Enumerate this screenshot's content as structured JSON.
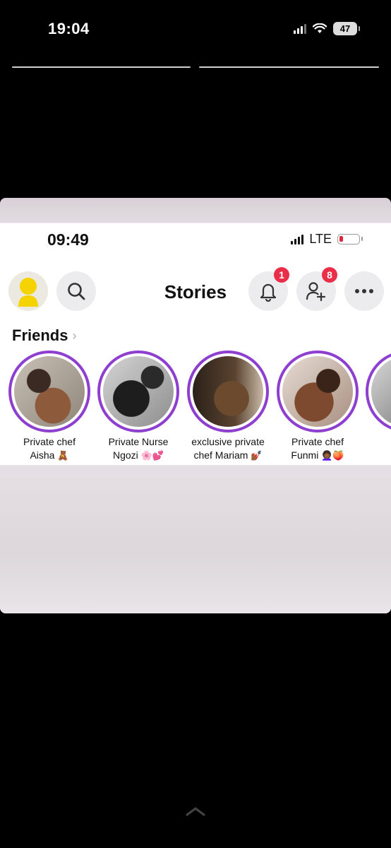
{
  "outer_status": {
    "time": "19:04",
    "battery": "47"
  },
  "inner_status": {
    "time": "09:49",
    "network": "LTE"
  },
  "header": {
    "title": "Stories",
    "notifications_count": "1",
    "friend_requests_count": "8"
  },
  "friends": {
    "label": "Friends",
    "stories": [
      {
        "line1": "Private chef",
        "line2": "Aisha",
        "emoji": "🧸"
      },
      {
        "line1": "Private Nurse",
        "line2": "Ngozi",
        "emoji": "🌸💕"
      },
      {
        "line1": "exclusive private",
        "line2": "chef Mariam",
        "emoji": "💅🏾"
      },
      {
        "line1": "Private chef",
        "line2": "Funmi",
        "emoji": "👩🏾‍🦱🍑"
      }
    ]
  },
  "colors": {
    "story_ring": "#8f3fcf",
    "badge": "#ea2e4a",
    "avatar": "#f5d300"
  }
}
